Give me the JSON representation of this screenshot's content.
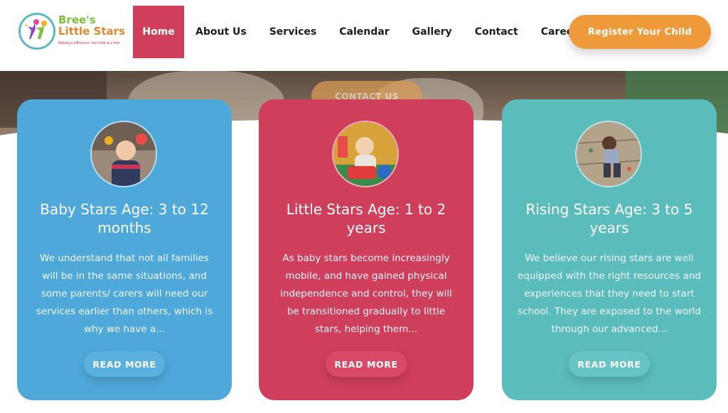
{
  "logo": {
    "line1": "Bree's",
    "line2": "Little Stars",
    "tagline": "Making a difference, one child at a time"
  },
  "nav": {
    "items": [
      {
        "label": "Home",
        "active": true
      },
      {
        "label": "About Us"
      },
      {
        "label": "Services"
      },
      {
        "label": "Calendar"
      },
      {
        "label": "Gallery"
      },
      {
        "label": "Contact"
      },
      {
        "label": "Careers"
      }
    ]
  },
  "register_label": "Register Your Child",
  "hero": {
    "contact_label": "CONTACT US"
  },
  "cards": [
    {
      "title": "Baby Stars Age: 3 to 12 months",
      "text": "We understand that not all families will be in the same situations, and some parents/ carers will need our services earlier than others, which is why we have a...",
      "button": "READ MORE",
      "color": "#4ea8da"
    },
    {
      "title": "Little Stars Age: 1 to 2 years",
      "text": "As baby stars become increasingly mobile, and have gained physical independence and control, they will be transitioned gradually to little stars, helping them...",
      "button": "READ MORE",
      "color": "#cf3e5b"
    },
    {
      "title": "Rising Stars Age: 3 to 5 years",
      "text": "We believe our rising stars are well equipped with the right resources and experiences that they need to start school. They are exposed to the world through our advanced...",
      "button": "READ MORE",
      "color": "#5bbcbc"
    }
  ],
  "colors": {
    "accent": "#cf3e5b",
    "register": "#ef9a3a"
  }
}
